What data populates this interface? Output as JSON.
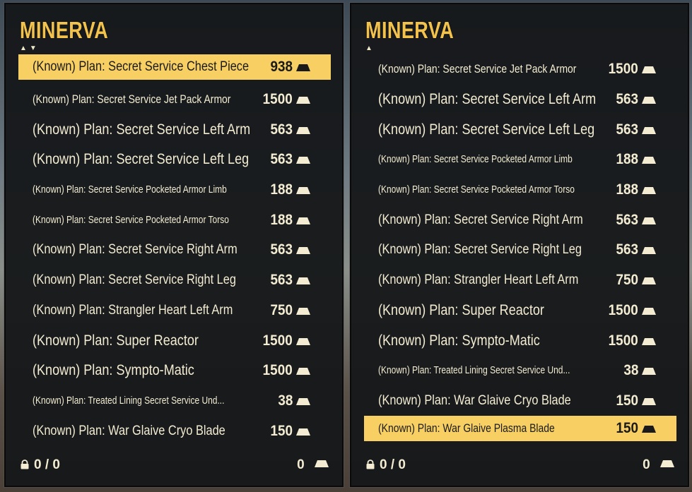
{
  "panels": [
    {
      "title": "MINERVA",
      "sort_indicators": [
        "▲",
        "▼"
      ],
      "items": [
        {
          "name": "(Known)  Plan: Secret Service Chest Piece",
          "price": "938",
          "size": "l",
          "selected": true
        },
        {
          "name": "(Known)  Plan: Secret Service Jet Pack Armor",
          "price": "1500",
          "size": "m",
          "selected": false
        },
        {
          "name": "(Known)  Plan: Secret Service Left Arm",
          "price": "563",
          "size": "xl",
          "selected": false
        },
        {
          "name": "(Known)  Plan: Secret Service Left Leg",
          "price": "563",
          "size": "xl",
          "selected": false
        },
        {
          "name": "(Known)  Plan: Secret Service Pocketed Armor Limb",
          "price": "188",
          "size": "s",
          "selected": false
        },
        {
          "name": "(Known)  Plan: Secret Service Pocketed Armor Torso",
          "price": "188",
          "size": "s",
          "selected": false
        },
        {
          "name": "(Known)  Plan: Secret Service Right Arm",
          "price": "563",
          "size": "l",
          "selected": false
        },
        {
          "name": "(Known)  Plan: Secret Service Right Leg",
          "price": "563",
          "size": "l",
          "selected": false
        },
        {
          "name": "(Known)  Plan: Strangler Heart Left Arm",
          "price": "750",
          "size": "l",
          "selected": false
        },
        {
          "name": "(Known)  Plan: Super Reactor",
          "price": "1500",
          "size": "xl",
          "selected": false
        },
        {
          "name": "(Known)  Plan: Sympto-Matic",
          "price": "1500",
          "size": "xl",
          "selected": false
        },
        {
          "name": "(Known)  Plan: Treated Lining Secret Service Und...",
          "price": "38",
          "size": "s",
          "selected": false
        },
        {
          "name": "(Known)  Plan: War Glaive Cryo Blade",
          "price": "150",
          "size": "l",
          "selected": false
        }
      ],
      "footer": {
        "weight": "0 / 0",
        "caps": "0"
      }
    },
    {
      "title": "MINERVA",
      "sort_indicators": [
        "▲"
      ],
      "items": [
        {
          "name": "(Known)  Plan: Secret Service Jet Pack Armor",
          "price": "1500",
          "size": "m",
          "selected": false
        },
        {
          "name": "(Known)  Plan: Secret Service Left Arm",
          "price": "563",
          "size": "xl",
          "selected": false
        },
        {
          "name": "(Known)  Plan: Secret Service Left Leg",
          "price": "563",
          "size": "xl",
          "selected": false
        },
        {
          "name": "(Known)  Plan: Secret Service Pocketed Armor Limb",
          "price": "188",
          "size": "s",
          "selected": false
        },
        {
          "name": "(Known)  Plan: Secret Service Pocketed Armor Torso",
          "price": "188",
          "size": "s",
          "selected": false
        },
        {
          "name": "(Known)  Plan: Secret Service Right Arm",
          "price": "563",
          "size": "l",
          "selected": false
        },
        {
          "name": "(Known)  Plan: Secret Service Right Leg",
          "price": "563",
          "size": "l",
          "selected": false
        },
        {
          "name": "(Known)  Plan: Strangler Heart Left Arm",
          "price": "750",
          "size": "l",
          "selected": false
        },
        {
          "name": "(Known)  Plan: Super Reactor",
          "price": "1500",
          "size": "xl",
          "selected": false
        },
        {
          "name": "(Known)  Plan: Sympto-Matic",
          "price": "1500",
          "size": "xl",
          "selected": false
        },
        {
          "name": "(Known)  Plan: Treated Lining Secret Service Und...",
          "price": "38",
          "size": "s",
          "selected": false
        },
        {
          "name": "(Known)  Plan: War Glaive Cryo Blade",
          "price": "150",
          "size": "l",
          "selected": false
        },
        {
          "name": "(Known)  Plan: War Glaive Plasma Blade",
          "price": "150",
          "size": "m",
          "selected": true
        }
      ],
      "footer": {
        "weight": "0 / 0",
        "caps": "0"
      }
    }
  ],
  "colors": {
    "accent": "#f2c24c",
    "highlight": "#f7cf62",
    "text": "#f3ecd2",
    "panel_bg": "#16181a"
  },
  "icons": {
    "currency": "caps-bar-icon",
    "weight": "lock-icon"
  }
}
